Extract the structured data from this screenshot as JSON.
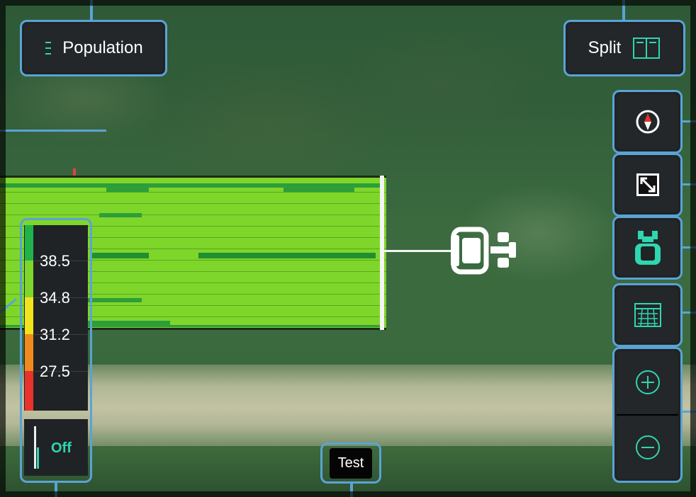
{
  "top_left": {
    "label": "Population",
    "icon": "layer-list-icon"
  },
  "top_right": {
    "label": "Split",
    "icon": "split-view-icon"
  },
  "side_controls": [
    {
      "name": "compass",
      "icon": "compass-icon"
    },
    {
      "name": "fit-extents",
      "icon": "expand-icon"
    },
    {
      "name": "follow-vehicle",
      "icon": "tractor-icon"
    },
    {
      "name": "field-boundary",
      "icon": "grid-icon"
    },
    {
      "name": "zoom-in",
      "icon": "plus-circle-icon"
    },
    {
      "name": "zoom-out",
      "icon": "minus-circle-icon"
    }
  ],
  "legend": {
    "values": [
      "38.5",
      "34.8",
      "31.2",
      "27.5"
    ],
    "colors": [
      "#1fb34a",
      "#7fd62a",
      "#f2e31b",
      "#f08a1c",
      "#e8322b"
    ],
    "toggle_label": "Off"
  },
  "test_badge": "Test",
  "colors": {
    "accent": "#5aa3d6",
    "teal": "#2fd6b0",
    "coverage": "#7fd62a"
  }
}
